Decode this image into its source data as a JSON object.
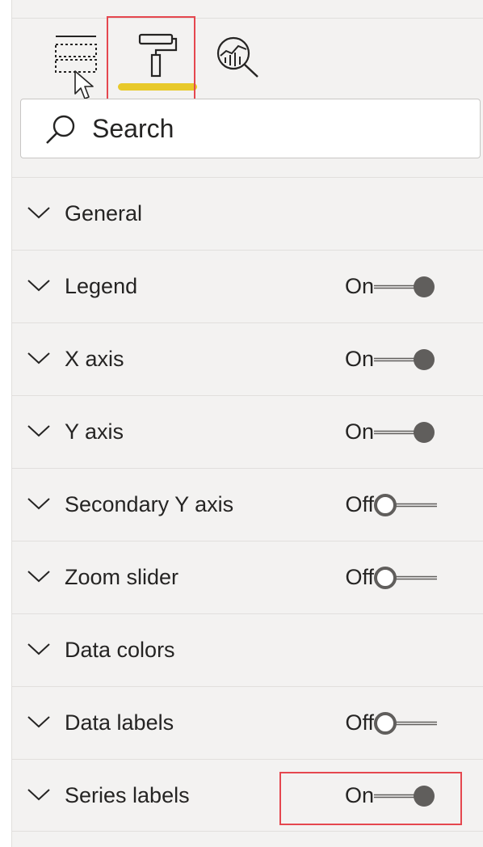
{
  "tabs": [
    {
      "icon": "fields-icon",
      "label": ""
    },
    {
      "icon": "paint-roller-icon",
      "label": "",
      "selected": true
    },
    {
      "icon": "analytics-magnifier-icon",
      "label": ""
    }
  ],
  "search": {
    "placeholder": "Search"
  },
  "sections": [
    {
      "label": "General",
      "toggle": null
    },
    {
      "label": "Legend",
      "toggle": "On"
    },
    {
      "label": "X axis",
      "toggle": "On"
    },
    {
      "label": "Y axis",
      "toggle": "On"
    },
    {
      "label": "Secondary Y axis",
      "toggle": "Off"
    },
    {
      "label": "Zoom slider",
      "toggle": "Off"
    },
    {
      "label": "Data colors",
      "toggle": null
    },
    {
      "label": "Data labels",
      "toggle": "Off"
    },
    {
      "label": "Series labels",
      "toggle": "On"
    }
  ],
  "colors": {
    "highlight": "#e5474f",
    "selected_tab_underline": "#e8c92a",
    "toggle_on_knob": "#605e5c",
    "background": "#f3f2f1"
  }
}
